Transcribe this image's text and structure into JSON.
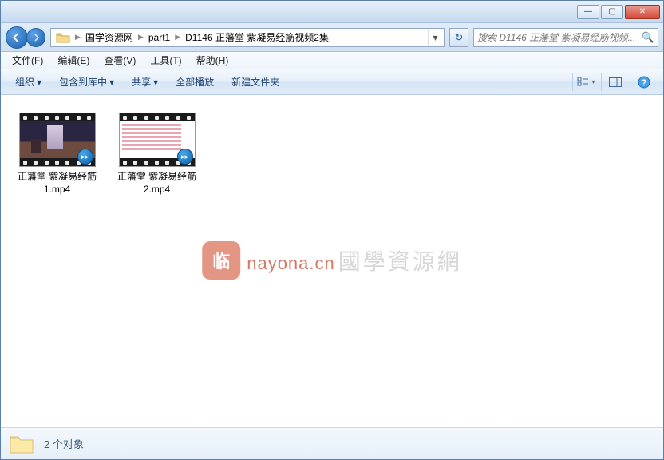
{
  "window_controls": {
    "min": "—",
    "max": "▢",
    "close": "✕"
  },
  "breadcrumb": {
    "items": [
      "国学资源网",
      "part1",
      "D1146 正藩堂 紫凝易经筋视频2集"
    ]
  },
  "search": {
    "placeholder": "搜索 D1146 正藩堂 紫凝易经筋视频..."
  },
  "menu": {
    "file": "文件(F)",
    "edit": "编辑(E)",
    "view": "查看(V)",
    "tools": "工具(T)",
    "help": "帮助(H)"
  },
  "toolbar": {
    "organize": "组织",
    "include": "包含到库中",
    "share": "共享",
    "playall": "全部播放",
    "newfolder": "新建文件夹"
  },
  "files": [
    {
      "name": "正藩堂 紫凝易经筋1.mp4"
    },
    {
      "name": "正藩堂 紫凝易经筋2.mp4"
    }
  ],
  "watermark": {
    "domain": "nayona.cn",
    "cn": "國學資源網"
  },
  "status": {
    "count_text": "2 个对象"
  }
}
